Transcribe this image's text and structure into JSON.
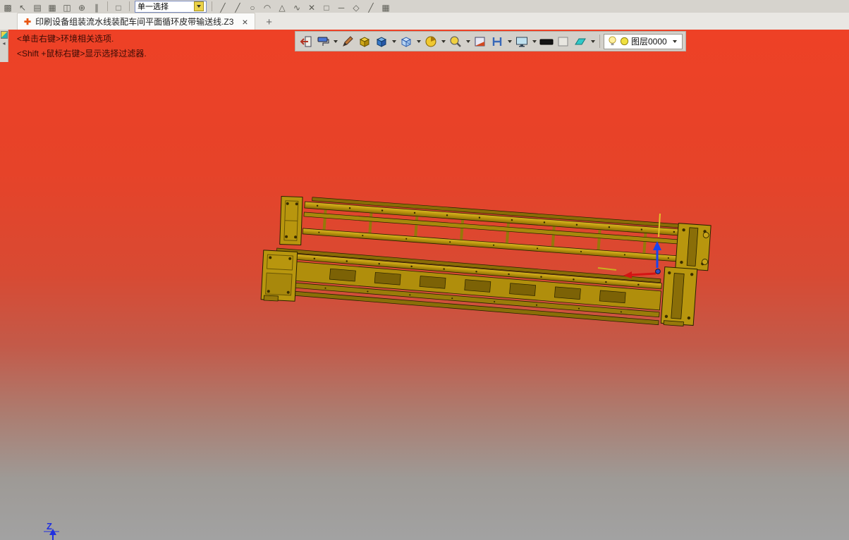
{
  "top_toolbar": {
    "selection_combo": "单一选择",
    "icon_names": [
      "grid",
      "cursor",
      "list",
      "table",
      "columns",
      "history",
      "hash",
      "parallel",
      "line-a",
      "line-b",
      "circle",
      "arc",
      "triangle",
      "spline",
      "delete",
      "cross",
      "box",
      "dash",
      "diamond",
      "slash",
      "panel"
    ]
  },
  "tab_bar": {
    "tab_title": "印刷设备组装流水线装配车间平面循环皮带输送线.Z3",
    "close_glyph": "×",
    "new_tab_glyph": "+"
  },
  "viewport": {
    "hint_line1": "<单击右键>环境相关选项.",
    "hint_line2": "<Shift +鼠标右键>显示选择过滤器.",
    "axis_z_label": "Z"
  },
  "floating_toolbar": {
    "layer_value": "图层0000",
    "icon_names": [
      "exit-environment",
      "render-mode",
      "pencil",
      "box",
      "shaded-cube",
      "wireframe-cube",
      "rotate-pie",
      "zoom",
      "section",
      "half-section",
      "display",
      "background-black",
      "color-swatch",
      "sheet",
      "layer-bulb",
      "layer-color"
    ]
  },
  "colors": {
    "bg_gradient_top": "#ee4126",
    "bg_gradient_bottom": "#a2a2a2",
    "model_yellow": "#b8940e",
    "axis_blue": "#2030e0",
    "axis_red": "#d41414"
  }
}
